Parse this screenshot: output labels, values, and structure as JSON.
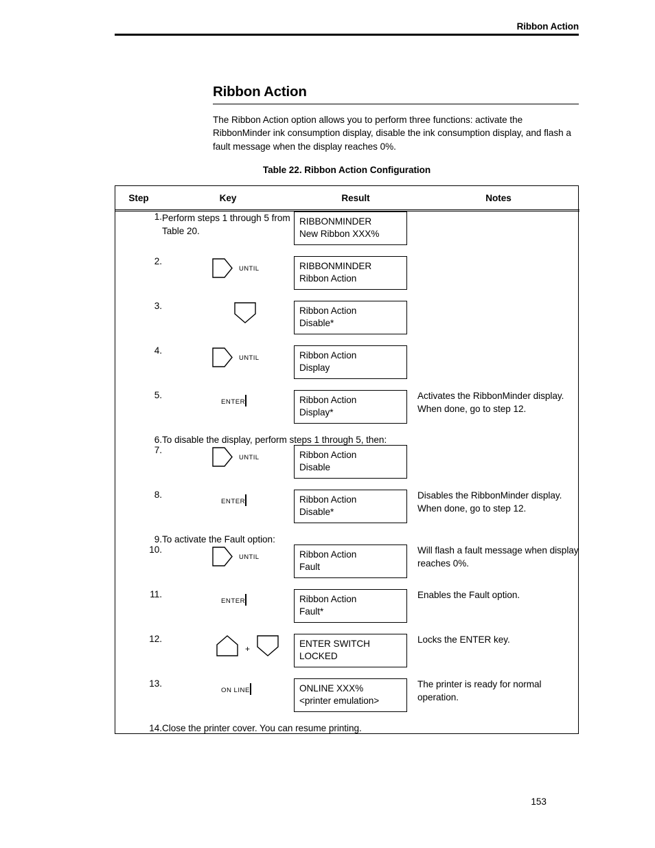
{
  "header": {
    "running_head": "Ribbon Action"
  },
  "section": {
    "title": "Ribbon Action",
    "intro": "The Ribbon Action option allows you to perform three functions: activate the RibbonMinder ink consumption display, disable the ink consumption display, and flash a fault message when the display reaches 0%."
  },
  "table": {
    "caption": "Table 22. Ribbon Action Configuration",
    "columns": [
      "Step",
      "Key",
      "Result",
      "Notes"
    ],
    "rows": [
      {
        "step": "1.",
        "key_type": "text",
        "key_text": "Perform steps 1 through 5 from Table 20.",
        "lcd_line1": "RIBBONMINDER",
        "lcd_line2": "New Ribbon XXX%",
        "note": ""
      },
      {
        "step": "2.",
        "key_type": "until",
        "key_label": "UNTIL",
        "lcd_line1": "RIBBONMINDER",
        "lcd_line2": "Ribbon Action",
        "note": ""
      },
      {
        "step": "3.",
        "key_type": "down",
        "key_label": "",
        "lcd_line1": "Ribbon Action",
        "lcd_line2": "Disable*",
        "note": ""
      },
      {
        "step": "4.",
        "key_type": "until",
        "key_label": "UNTIL",
        "lcd_line1": "Ribbon Action",
        "lcd_line2": "Display",
        "note": ""
      },
      {
        "step": "5.",
        "key_type": "labeled",
        "key_label": "ENTER",
        "lcd_line1": "Ribbon Action",
        "lcd_line2": "Display*",
        "note": "Activates the RibbonMinder display. When done, go to step 12."
      },
      {
        "step": "6.",
        "key_type": "wide",
        "key_text": "To disable the display, perform steps 1 through 5, then:"
      },
      {
        "step": "7.",
        "key_type": "until",
        "key_label": "UNTIL",
        "lcd_line1": "Ribbon Action",
        "lcd_line2": "Disable",
        "note": ""
      },
      {
        "step": "8.",
        "key_type": "labeled",
        "key_label": "ENTER",
        "lcd_line1": "Ribbon Action",
        "lcd_line2": "Disable*",
        "note": "Disables the RibbonMinder display. When done, go to step 12."
      },
      {
        "step": "9.",
        "key_type": "wide",
        "key_text": "To activate the Fault option:"
      },
      {
        "step": "10.",
        "key_type": "until",
        "key_label": "UNTIL",
        "lcd_line1": "Ribbon Action",
        "lcd_line2": "Fault",
        "note": "Will flash a fault message when display reaches 0%."
      },
      {
        "step": "11.",
        "key_type": "labeled",
        "key_label": "ENTER",
        "lcd_line1": "Ribbon Action",
        "lcd_line2": "Fault*",
        "note": "Enables the Fault option."
      },
      {
        "step": "12.",
        "key_type": "combo",
        "key_label": "+",
        "lcd_line1": "ENTER SWITCH",
        "lcd_line2": "LOCKED",
        "note": "Locks the ENTER key."
      },
      {
        "step": "13.",
        "key_type": "labeled",
        "key_label": "ON LINE",
        "lcd_line1": "ONLINE        XXX%",
        "lcd_line2": "<printer emulation>",
        "note": "The printer is ready for normal operation."
      },
      {
        "step": "14.",
        "key_type": "wide",
        "key_text": "Close the printer cover. You can resume printing."
      }
    ]
  },
  "footer": {
    "page_number": "153"
  }
}
